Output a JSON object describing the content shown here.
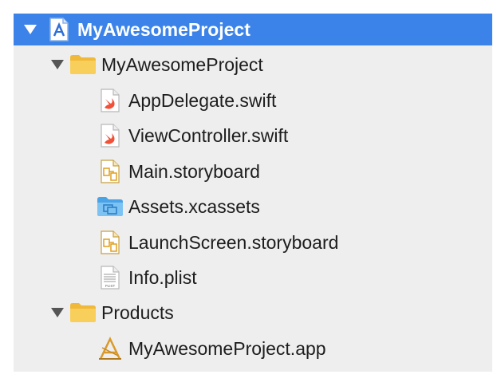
{
  "navigator": {
    "project": {
      "label": "MyAwesomeProject",
      "icon": "xcode-project-icon",
      "expanded": true
    },
    "group_main": {
      "label": "MyAwesomeProject",
      "icon": "folder-icon",
      "expanded": true
    },
    "files": [
      {
        "label": "AppDelegate.swift",
        "icon": "swift-file-icon"
      },
      {
        "label": "ViewController.swift",
        "icon": "swift-file-icon"
      },
      {
        "label": "Main.storyboard",
        "icon": "storyboard-file-icon"
      },
      {
        "label": "Assets.xcassets",
        "icon": "asset-catalog-icon"
      },
      {
        "label": "LaunchScreen.storyboard",
        "icon": "storyboard-file-icon"
      },
      {
        "label": "Info.plist",
        "icon": "plist-file-icon"
      }
    ],
    "group_products": {
      "label": "Products",
      "icon": "folder-icon",
      "expanded": true
    },
    "product": {
      "label": "MyAwesomeProject.app",
      "icon": "app-product-icon"
    },
    "plist_badge": "PLIST",
    "colors": {
      "selection": "#3b83e8",
      "folder": "#f5c542",
      "swift": "#f05138",
      "assets": "#5fb0e8"
    }
  }
}
